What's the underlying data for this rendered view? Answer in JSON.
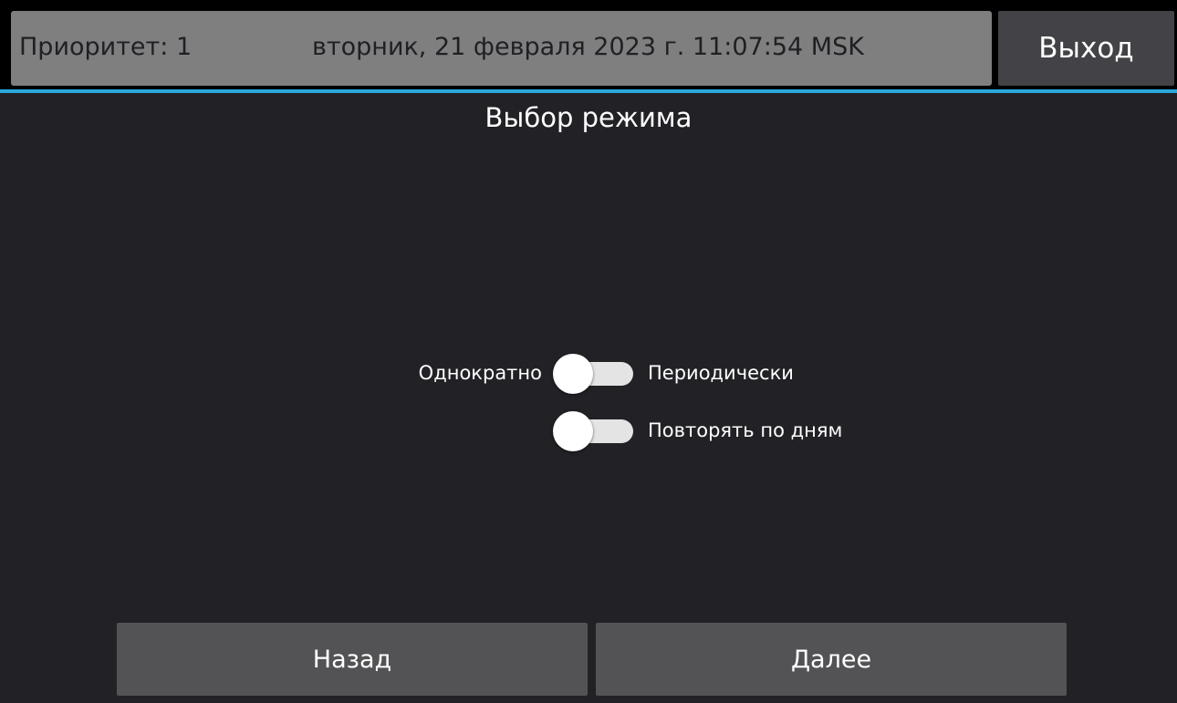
{
  "header": {
    "priority": "Приоритет: 1",
    "datetime": "вторник, 21 февраля 2023 г. 11:07:54 MSK",
    "exit_label": "Выход"
  },
  "page": {
    "title": "Выбор режима"
  },
  "mode": {
    "left_label": "Однократно",
    "right_label": "Периодически",
    "periodic_on": false,
    "repeat_label": "Повторять по дням",
    "repeat_on": false
  },
  "footer": {
    "back_label": "Назад",
    "next_label": "Далее"
  },
  "colors": {
    "background": "#222126",
    "status_bar": "#7f7f7f",
    "accent": "#2aa9dc",
    "button": "#535355",
    "exit_button": "#434347"
  }
}
